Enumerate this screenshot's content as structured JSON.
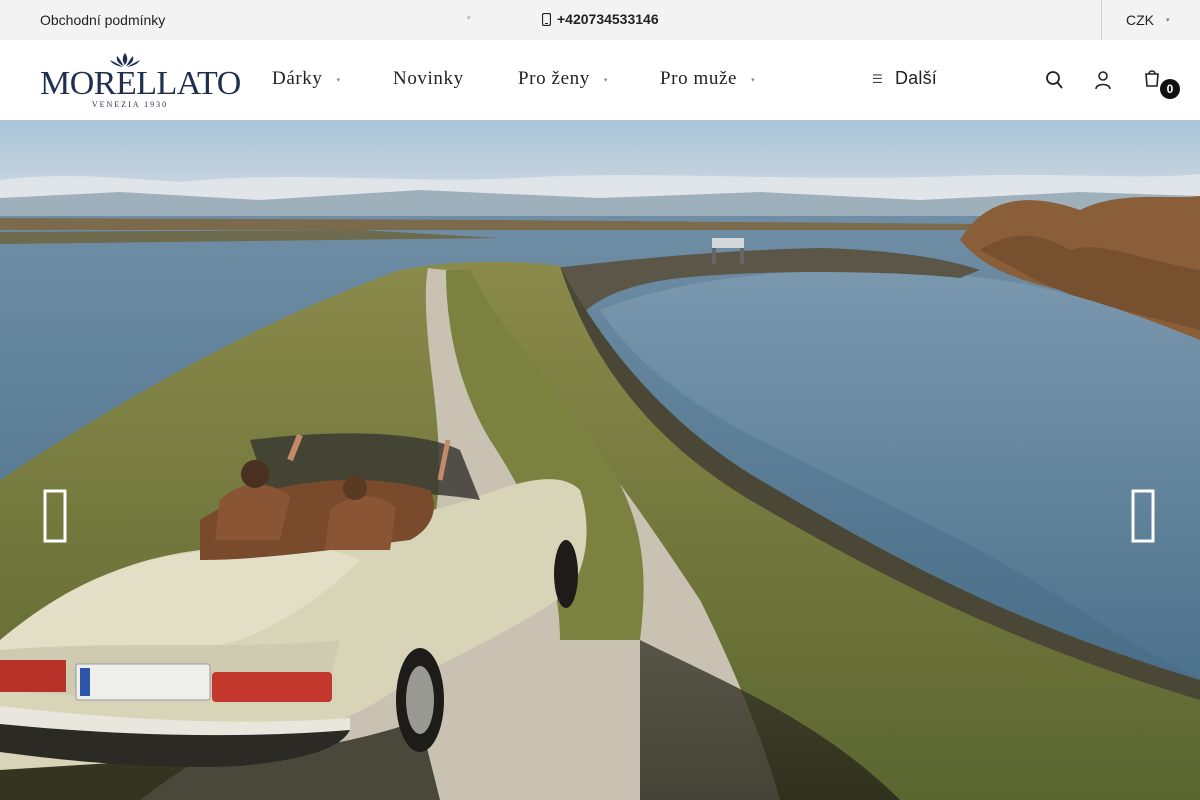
{
  "topbar": {
    "terms_link": "Obchodní podmínky",
    "phone": "+420734533146",
    "currency": "CZK"
  },
  "logo": {
    "brand": "MORELLATO",
    "tagline": "VENEZIA 1930"
  },
  "nav": {
    "items": [
      {
        "label": "Dárky",
        "has_dropdown": true
      },
      {
        "label": "Novinky",
        "has_dropdown": false
      },
      {
        "label": "Pro ženy",
        "has_dropdown": true
      },
      {
        "label": "Pro muže",
        "has_dropdown": true
      }
    ],
    "more_label": "Další"
  },
  "header_icons": [
    "search-icon",
    "account-icon",
    "cart-icon"
  ],
  "cart": {
    "count": "0"
  },
  "hero": {
    "image_subject": "vintage convertible on gravel lagoon road",
    "prev_icon": "chevron-left-icon",
    "next_icon": "chevron-right-icon"
  },
  "colors": {
    "topbar_bg": "#f3f3f3",
    "brand_navy": "#1f2f52",
    "badge_bg": "#111111"
  }
}
